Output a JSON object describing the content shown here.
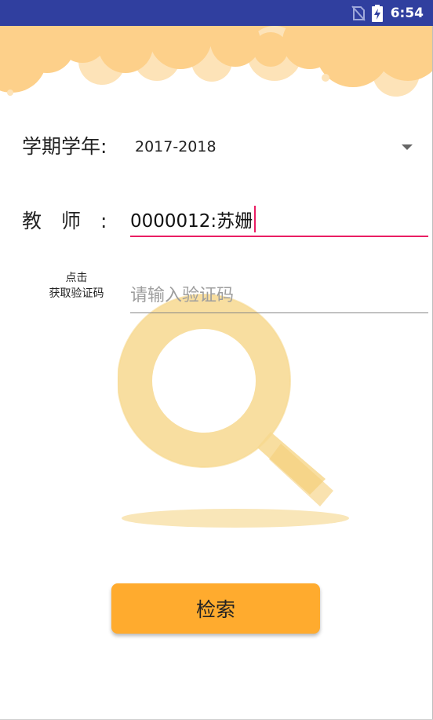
{
  "status_bar": {
    "time": "6:54",
    "icons": [
      "no-sim-icon",
      "battery-charging-icon"
    ],
    "background": "#303f9f"
  },
  "form": {
    "term_label": "学期学年:",
    "term_value": "2017-2018",
    "teacher_label": "教　师　:",
    "teacher_value": "0000012:苏姗",
    "captcha_link_line1": "点击",
    "captcha_link_line2": "获取验证码",
    "captcha_placeholder": "请输入验证码",
    "captcha_value": ""
  },
  "search_button_label": "检索",
  "colors": {
    "accent": "#e91e63",
    "button": "#ffab2e",
    "cloud": "#fdd08a",
    "watermark": "#f7d88f"
  },
  "icons": {
    "dropdown": "dropdown-arrow-icon",
    "watermark": "magnifier-icon"
  }
}
